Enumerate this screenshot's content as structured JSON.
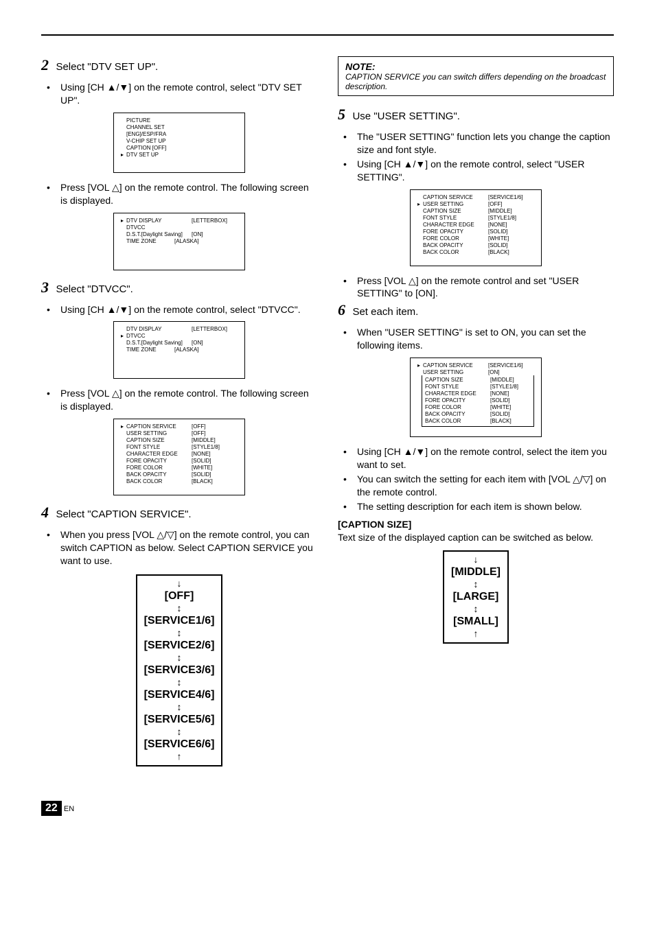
{
  "step2": {
    "title": "Select \"DTV SET UP\".",
    "b1": "Using [CH ▲/▼] on the remote control, select \"DTV SET UP\".",
    "b2": "Press [VOL △] on the remote control. The following screen is displayed."
  },
  "screen1": {
    "r1": "PICTURE",
    "r2": "CHANNEL SET",
    "r3": "[ENG]/ESP/FRA",
    "r4": "V-CHIP SET UP",
    "r5": "CAPTION [OFF]",
    "r6": "DTV SET UP"
  },
  "screen2": {
    "r1l": "DTV DISPLAY",
    "r1v": "[LETTERBOX]",
    "r2l": "DTVCC",
    "r2v": "",
    "r3l": "D.S.T.[Daylight Saving]",
    "r3v": "[ON]",
    "r4l": "TIME ZONE",
    "r4v": "[ALASKA]"
  },
  "step3": {
    "title": "Select \"DTVCC\".",
    "b1": "Using [CH ▲/▼] on the remote control, select \"DTVCC\".",
    "b2": "Press [VOL △] on the remote control. The following screen is displayed."
  },
  "screen3": {
    "r1l": "DTV DISPLAY",
    "r1v": "[LETTERBOX]",
    "r2l": "DTVCC",
    "r2v": "",
    "r3l": "D.S.T.[Daylight Saving]",
    "r3v": "[ON]",
    "r4l": "TIME ZONE",
    "r4v": "[ALASKA]"
  },
  "screen4": {
    "r1l": "CAPTION SERVICE",
    "r1v": "[OFF]",
    "r2l": "USER SETTING",
    "r2v": "[OFF]",
    "r3l": "CAPTION SIZE",
    "r3v": "[MIDDLE]",
    "r4l": "FONT STYLE",
    "r4v": "[STYLE1/8]",
    "r5l": "CHARACTER EDGE",
    "r5v": "[NONE]",
    "r6l": "FORE OPACITY",
    "r6v": "[SOLID]",
    "r7l": "FORE COLOR",
    "r7v": "[WHITE]",
    "r8l": "BACK OPACITY",
    "r8v": "[SOLID]",
    "r9l": "BACK COLOR",
    "r9v": "[BLACK]"
  },
  "step4": {
    "title": "Select \"CAPTION SERVICE\".",
    "b1": "When you press [VOL △/▽] on the remote control, you can switch CAPTION as below. Select CAPTION SERVICE you want to use."
  },
  "cycle1": {
    "i1": "[OFF]",
    "i2": "[SERVICE1/6]",
    "i3": "[SERVICE2/6]",
    "i4": "[SERVICE3/6]",
    "i5": "[SERVICE4/6]",
    "i6": "[SERVICE5/6]",
    "i7": "[SERVICE6/6]"
  },
  "note": {
    "head": "NOTE:",
    "body": "CAPTION SERVICE you can switch differs depending on the broadcast description."
  },
  "step5": {
    "title": "Use \"USER SETTING\".",
    "b1": "The \"USER SETTING\" function lets you change the caption size and font style.",
    "b2": "Using [CH ▲/▼] on the remote control, select \"USER SETTING\".",
    "b3": "Press [VOL △] on the remote control and set \"USER SETTING\" to [ON]."
  },
  "screen5": {
    "r1l": "CAPTION SERVICE",
    "r1v": "[SERVICE1/6]",
    "r2l": "USER SETTING",
    "r2v": "[OFF]",
    "r3l": "CAPTION SIZE",
    "r3v": "[MIDDLE]",
    "r4l": "FONT STYLE",
    "r4v": "[STYLE1/8]",
    "r5l": "CHARACTER EDGE",
    "r5v": "[NONE]",
    "r6l": "FORE OPACITY",
    "r6v": "[SOLID]",
    "r7l": "FORE COLOR",
    "r7v": "[WHITE]",
    "r8l": "BACK OPACITY",
    "r8v": "[SOLID]",
    "r9l": "BACK COLOR",
    "r9v": "[BLACK]"
  },
  "step6": {
    "title": "Set each item.",
    "b1": "When \"USER SETTING\" is set to ON, you can set the following items.",
    "b2": "Using [CH ▲/▼] on the remote control, select the item you want to set.",
    "b3": "You can switch the setting for each item with [VOL △/▽] on the remote control.",
    "b4": "The setting description for each item is shown below."
  },
  "screen6": {
    "r1l": "CAPTION SERVICE",
    "r1v": "[SERVICE1/6]",
    "r2l": "USER SETTING",
    "r2v": "[ON]",
    "r3l": "CAPTION SIZE",
    "r3v": "[MIDDLE]",
    "r4l": "FONT STYLE",
    "r4v": "[STYLE1/8]",
    "r5l": "CHARACTER EDGE",
    "r5v": "[NONE]",
    "r6l": "FORE OPACITY",
    "r6v": "[SOLID]",
    "r7l": "FORE COLOR",
    "r7v": "[WHITE]",
    "r8l": "BACK OPACITY",
    "r8v": "[SOLID]",
    "r9l": "BACK COLOR",
    "r9v": "[BLACK]"
  },
  "caption_size": {
    "head": "[CAPTION SIZE]",
    "body": "Text size of the displayed caption can be switched as below."
  },
  "cycle2": {
    "i1": "[MIDDLE]",
    "i2": "[LARGE]",
    "i3": "[SMALL]"
  },
  "pagenum": "22",
  "pagelabel": "EN"
}
